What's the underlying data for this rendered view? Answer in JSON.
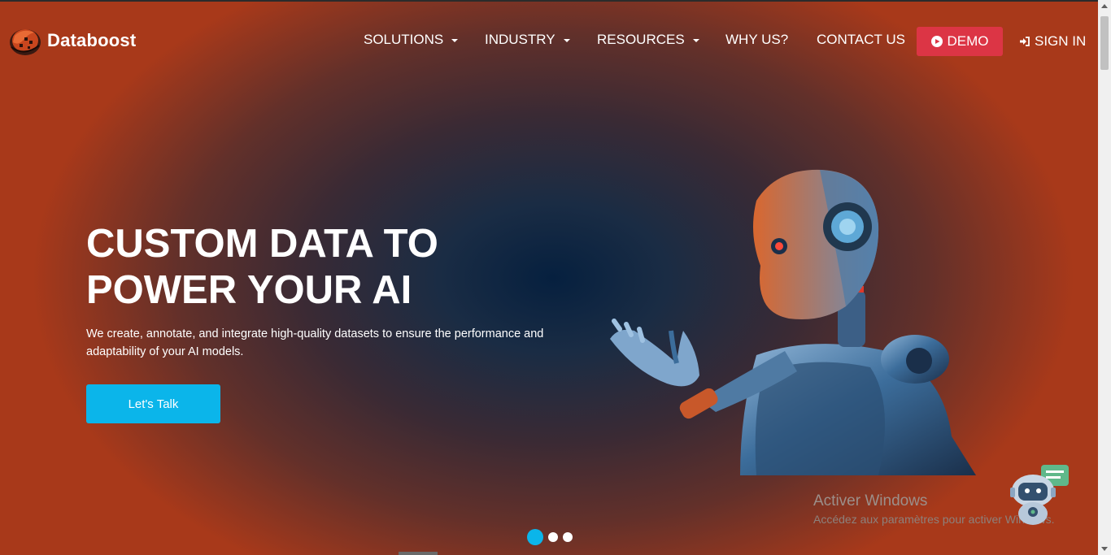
{
  "brand": {
    "name": "Databoost"
  },
  "nav": {
    "items": [
      {
        "label": "SOLUTIONS",
        "dropdown": true
      },
      {
        "label": "INDUSTRY",
        "dropdown": true
      },
      {
        "label": "RESOURCES",
        "dropdown": true
      },
      {
        "label": "WHY US?",
        "dropdown": false
      },
      {
        "label": "CONTACT US",
        "dropdown": false
      }
    ],
    "demo_label": "DEMO",
    "signin_label": "SIGN IN"
  },
  "hero": {
    "title_line1": "CUSTOM DATA TO",
    "title_line2": "POWER YOUR AI",
    "description": "We create, annotate, and integrate high-quality datasets to ensure the performance and adaptability of your AI models.",
    "cta_label": "Let's Talk"
  },
  "carousel": {
    "slides": 3,
    "active": 1
  },
  "watermark": {
    "title": "Activer Windows",
    "subtitle": "Accédez aux paramètres pour activer Windows."
  },
  "colors": {
    "accent": "#0bb5ea",
    "demo": "#dc3545",
    "edge_orange": "#a8391a",
    "center_navy": "#06203f"
  },
  "icons": {
    "logo": "databoost-logo-icon",
    "play": "play-circle-icon",
    "signin": "sign-in-icon",
    "chat": "chatbot-icon"
  }
}
